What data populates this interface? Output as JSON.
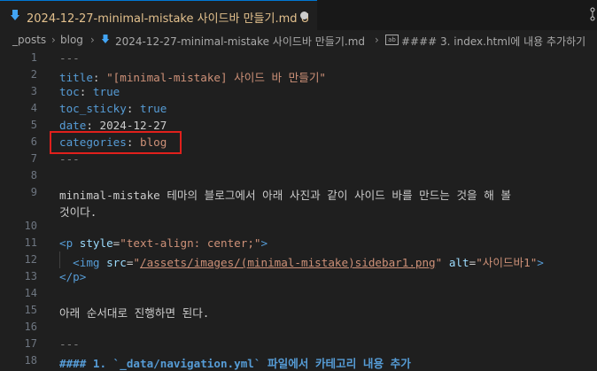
{
  "tab": {
    "title": "2024-12-27-minimal-mistake 사이드바 만들기.md",
    "status": "U"
  },
  "breadcrumb": {
    "folder1": "_posts",
    "folder2": "blog",
    "file": "2024-12-27-minimal-mistake 사이드바 만들기.md",
    "symbol": "#### 3. index.html에 내용 추가하기"
  },
  "lines": [
    {
      "n": "1",
      "parts": [
        [
          "g",
          "---"
        ]
      ]
    },
    {
      "n": "2",
      "parts": [
        [
          "k",
          "title"
        ],
        [
          "w",
          ": "
        ],
        [
          "s",
          "\"[minimal-mistake] 사이드 바 만들기\""
        ]
      ]
    },
    {
      "n": "3",
      "parts": [
        [
          "k",
          "toc"
        ],
        [
          "w",
          ": "
        ],
        [
          "k",
          "true"
        ]
      ]
    },
    {
      "n": "4",
      "parts": [
        [
          "k",
          "toc_sticky"
        ],
        [
          "w",
          ": "
        ],
        [
          "k",
          "true"
        ]
      ]
    },
    {
      "n": "5",
      "parts": [
        [
          "k",
          "date"
        ],
        [
          "w",
          ": 2024-12-27"
        ]
      ]
    },
    {
      "n": "6",
      "parts": [
        [
          "k",
          "categories"
        ],
        [
          "w",
          ": "
        ],
        [
          "s",
          "blog"
        ]
      ]
    },
    {
      "n": "7",
      "parts": [
        [
          "g",
          "---"
        ]
      ]
    },
    {
      "n": "8",
      "parts": []
    },
    {
      "n": "9",
      "parts": [
        [
          "w",
          "minimal-mistake 테마의 블로그에서 아래 사진과 같이 사이드 바를 만드는 것을 해 볼"
        ]
      ]
    },
    {
      "n": "",
      "parts": [
        [
          "w",
          "것이다."
        ]
      ]
    },
    {
      "n": "10",
      "parts": []
    },
    {
      "n": "11",
      "parts": [
        [
          "t",
          "<p "
        ],
        [
          "a",
          "style"
        ],
        [
          "w",
          "="
        ],
        [
          "s",
          "\"text-align: center;\""
        ],
        [
          "t",
          ">"
        ]
      ]
    },
    {
      "n": "12",
      "parts": [
        [
          "w",
          "  "
        ],
        [
          "t",
          "<img "
        ],
        [
          "a",
          "src"
        ],
        [
          "w",
          "="
        ],
        [
          "s",
          "\""
        ],
        [
          "su",
          "/assets/images/(minimal-mistake)sidebar1.png"
        ],
        [
          "s",
          "\""
        ],
        [
          "w",
          " "
        ],
        [
          "a",
          "alt"
        ],
        [
          "w",
          "="
        ],
        [
          "s",
          "\"사이드바1\""
        ],
        [
          "t",
          ">"
        ]
      ]
    },
    {
      "n": "13",
      "parts": [
        [
          "t",
          "</p>"
        ]
      ]
    },
    {
      "n": "14",
      "parts": []
    },
    {
      "n": "15",
      "parts": [
        [
          "w",
          "아래 순서대로 진행하면 된다."
        ]
      ]
    },
    {
      "n": "16",
      "parts": []
    },
    {
      "n": "17",
      "parts": [
        [
          "g",
          "---"
        ]
      ]
    },
    {
      "n": "18",
      "parts": [
        [
          "h",
          "#### 1. `_data/navigation.yml` 파일에서 카테고리 내용 추가"
        ]
      ]
    }
  ]
}
